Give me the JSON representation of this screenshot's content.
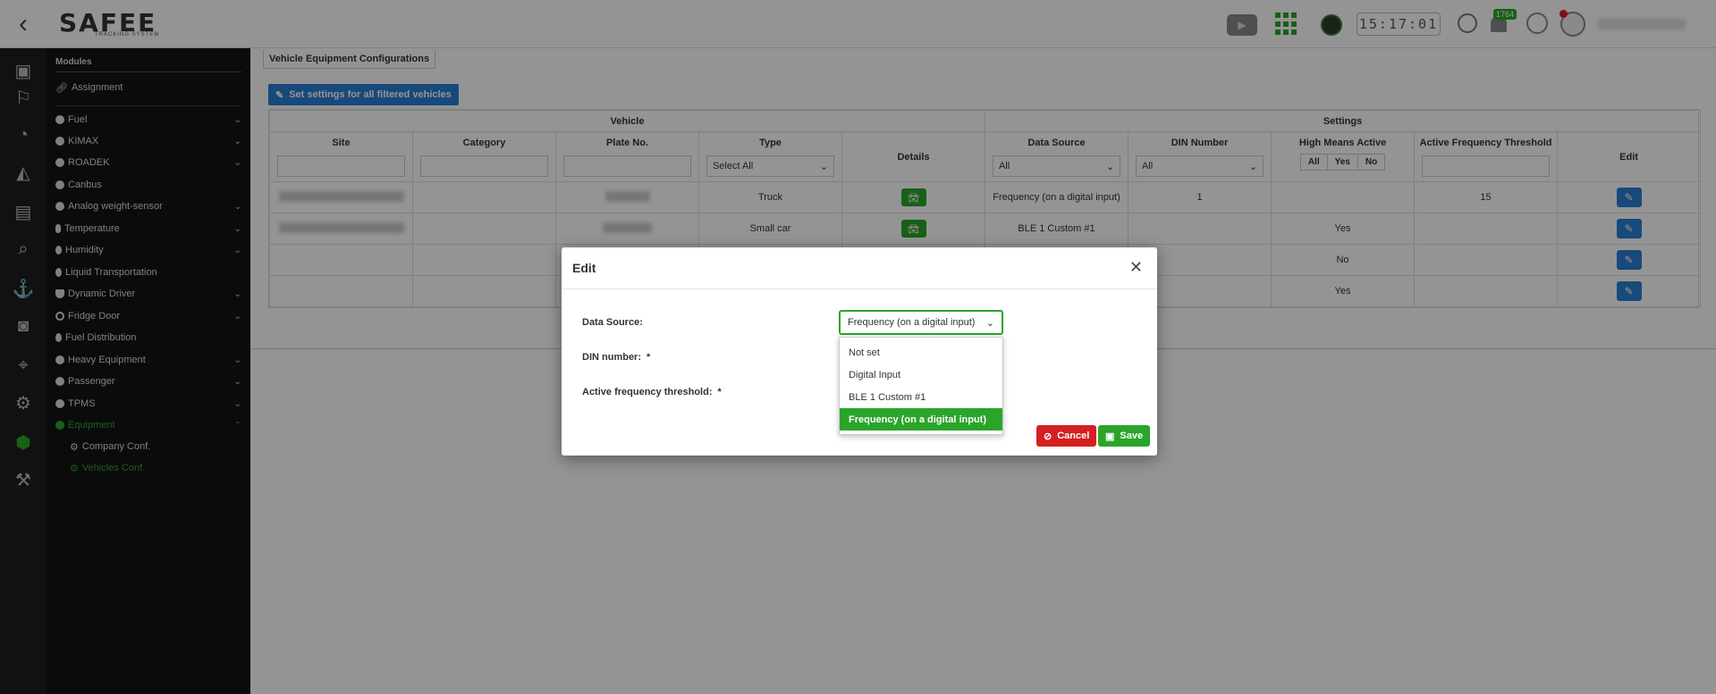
{
  "header": {
    "logo_text": "SAFEE",
    "logo_sub": "TRACKING SYSTEM",
    "clock": "15:17:01",
    "notification_count": "1764"
  },
  "sidebar": {
    "title": "Modules",
    "items": [
      {
        "label": "Assignment",
        "icon": "link-icon",
        "has_chevron": false
      },
      {
        "label": "Fuel",
        "icon": "fuel-icon",
        "has_chevron": true
      },
      {
        "label": "KIMAX",
        "icon": "circle-icon",
        "has_chevron": true
      },
      {
        "label": "ROADEK",
        "icon": "circle-icon",
        "has_chevron": true
      },
      {
        "label": "Canbus",
        "icon": "circle-icon",
        "has_chevron": false
      },
      {
        "label": "Analog weight-sensor",
        "icon": "circle-icon",
        "has_chevron": true
      },
      {
        "label": "Temperature",
        "icon": "thermometer-icon",
        "has_chevron": true
      },
      {
        "label": "Humidity",
        "icon": "drop-icon",
        "has_chevron": true
      },
      {
        "label": "Liquid Transportation",
        "icon": "drop-icon",
        "has_chevron": false
      },
      {
        "label": "Dynamic Driver",
        "icon": "shield-icon",
        "has_chevron": true
      },
      {
        "label": "Fridge Door",
        "icon": "door-icon",
        "has_chevron": true
      },
      {
        "label": "Fuel Distribution",
        "icon": "drop-icon",
        "has_chevron": false
      },
      {
        "label": "Heavy Equipment",
        "icon": "circle-icon",
        "has_chevron": true
      },
      {
        "label": "Passenger",
        "icon": "circle-icon",
        "has_chevron": true
      },
      {
        "label": "TPMS",
        "icon": "circle-icon",
        "has_chevron": true
      },
      {
        "label": "Equipment",
        "icon": "circle-icon",
        "has_chevron": true,
        "active": true
      },
      {
        "label": "Company Conf.",
        "icon": "gears-icon",
        "has_chevron": false,
        "sub": true
      },
      {
        "label": "Vehicles Conf.",
        "icon": "gears-icon",
        "has_chevron": false,
        "sub": true,
        "active": true
      }
    ]
  },
  "main": {
    "tab_label": "Vehicle Equipment Configurations",
    "set_button": "Set settings for all filtered vehicles",
    "group_headers": {
      "vehicle": "Vehicle",
      "settings": "Settings"
    },
    "columns": {
      "site": "Site",
      "category": "Category",
      "plate": "Plate No.",
      "type": "Type",
      "details": "Details",
      "data_source": "Data Source",
      "din": "DIN Number",
      "hma": "High Means Active",
      "aft": "Active Frequency Threshold",
      "edit": "Edit"
    },
    "filters": {
      "type": "Select All",
      "data_source": "All",
      "din": "All",
      "hma_all": "All",
      "hma_yes": "Yes",
      "hma_no": "No"
    },
    "rows": [
      {
        "type": "Truck",
        "data_source": "Frequency (on a digital input)",
        "din": "1",
        "hma": "",
        "aft": "15"
      },
      {
        "type": "Small car",
        "data_source": "BLE 1 Custom #1",
        "din": "",
        "hma": "Yes",
        "aft": ""
      },
      {
        "type": "",
        "data_source": "",
        "din": "",
        "hma": "No",
        "aft": ""
      },
      {
        "type": "",
        "data_source": "",
        "din": "",
        "hma": "Yes",
        "aft": ""
      }
    ]
  },
  "modal": {
    "title": "Edit",
    "labels": {
      "data_source": "Data Source:",
      "din": "DIN number:",
      "aft": "Active frequency threshold:",
      "required": "*"
    },
    "data_source_value": "Frequency (on a digital input)",
    "options": [
      "Not set",
      "Digital Input",
      "BLE 1 Custom #1",
      "Frequency (on a digital input)"
    ],
    "selected_option": "Frequency (on a digital input)",
    "cancel": "Cancel",
    "save": "Save"
  },
  "colors": {
    "accent_green": "#2aa52a",
    "accent_blue": "#2a7fd4",
    "danger_red": "#d42020",
    "sidebar_bg": "#131313"
  }
}
